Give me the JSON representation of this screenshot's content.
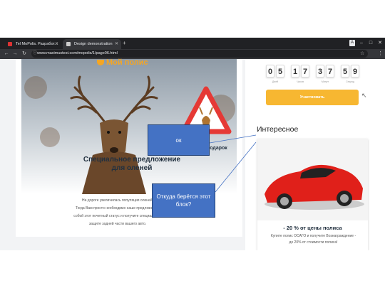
{
  "browser": {
    "tabs": [
      {
        "label": "Tel MoPolis. Разработ...",
        "active": false
      },
      {
        "label": "Design demonstration",
        "active": true
      }
    ],
    "url": "www.maximustest.com/mopolis/1/page06.html",
    "window_controls": [
      "–",
      "□",
      "✕"
    ]
  },
  "site": {
    "logo": "Мой полис",
    "promo_line1": "Специальное предложение",
    "promo_line2": "для оленей",
    "gift_label": "подарок",
    "body_lines": [
      "На дороге увеличилась популяция оленей.",
      "Тогда Вам просто необходимо наше предложение.",
      "собой этот почетный статус и получите специальную",
      "защите задней части вашего авто."
    ]
  },
  "countdown": {
    "digits": [
      "0",
      "5",
      "1",
      "7",
      "3",
      "7",
      "5",
      "9"
    ],
    "units": [
      "Дней",
      "Часов",
      "Минут",
      "Секунд"
    ]
  },
  "cta_label": "Участвовать",
  "interesting": {
    "heading": "Интересное",
    "offer": "- 20 % от цены полиса",
    "offer_sub_1": "Купите полис ОСАГО и получите Вознаграждение -",
    "offer_sub_2": "до 20% от стоимости полиса!"
  },
  "annotations": {
    "ok": "ок",
    "question": "Откуда берётся этот блок?"
  },
  "colors": {
    "accent": "#f7b731",
    "note_fill": "#4472c4",
    "brand_text": "#22303f"
  }
}
